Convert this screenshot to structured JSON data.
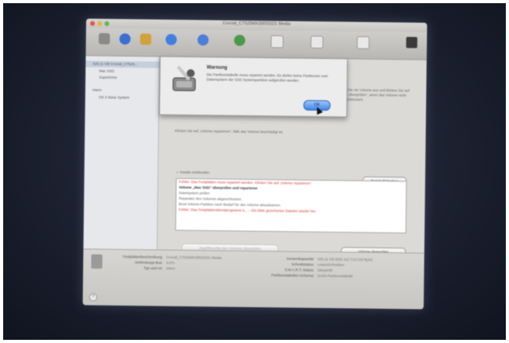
{
  "window": {
    "title": "Crucial_CT525MX300SSD1 Media"
  },
  "sidebar": {
    "items": [
      {
        "label": "525,11 GB Crucial_CT525..."
      },
      {
        "label": "Mac SSD"
      },
      {
        "label": "SuperDrive"
      },
      {
        "label": "Intern"
      },
      {
        "label": "OS X Base System"
      }
    ]
  },
  "main": {
    "description": "Wählen Sie ein Volume aus und klicken Sie auf „Volume überprüfen“, wenn das Volume nicht richtig funktioniert.",
    "description2": "Klicken Sie auf „Volume reparieren“, falls das Volume beschädigt ist.",
    "show_details_label": "Details einblenden",
    "clear_history_label": "Protokoll löschen",
    "log": [
      {
        "text": "Fehler: Das Festplatten muss repariert werden. Klicken Sie auf „Volume reparieren“.",
        "style": "red"
      },
      {
        "text": "Volume „Mac SSD“ überprüfen und reparieren",
        "style": "bold"
      },
      {
        "text": "Dateisystem prüfen",
        "style": "gray"
      },
      {
        "text": "Reparatur des Volumes abgeschlossen.",
        "style": "gray"
      },
      {
        "text": "Boot-Volume-Partition nach Bedarf für das Volume aktualisieren.",
        "style": "gray"
      },
      {
        "text": "Fehler: Das Festplattendienstprogramm k... – Ein Bitte gesicherten Dateien wieder her.",
        "style": "red"
      }
    ],
    "btn_verify_permissions": "Zugriffsrechte des Volumes überprüfen",
    "btn_repair_permissions": "Zugriffsrechte des Volumes reparieren",
    "btn_verify_volume": "Volume überprüfen",
    "btn_repair_volume": "Volume reparieren"
  },
  "info": {
    "left": [
      {
        "key": "Festplattenbeschreibung:",
        "value": "Crucial_CT525MX300SSD1 Media"
      },
      {
        "key": "Verbindungs-Bus:",
        "value": "SATA"
      },
      {
        "key": "Typ und Art:",
        "value": "Intern"
      }
    ],
    "right": [
      {
        "key": "Gesamtkapazität:",
        "value": "525,11 GB (525.112.713.216 Byte)"
      },
      {
        "key": "Schreibstatus:",
        "value": "Lesen/Schreiben"
      },
      {
        "key": "S.M.A.R.T.-Status:",
        "value": "Überprüft"
      },
      {
        "key": "Partitionstabellen-Schema:",
        "value": "GUID-Partitionstabelle"
      }
    ]
  },
  "dialog": {
    "title": "Warnung",
    "message": "Die Partitionstabelle muss repariert werden. Es dürfen keine Partitionen vom Datensystem der SSD Systempartition aufgerufen werden.",
    "ok_label": "OK"
  },
  "colors": {
    "accent": "#3f86e8",
    "error": "#d23a3a"
  }
}
